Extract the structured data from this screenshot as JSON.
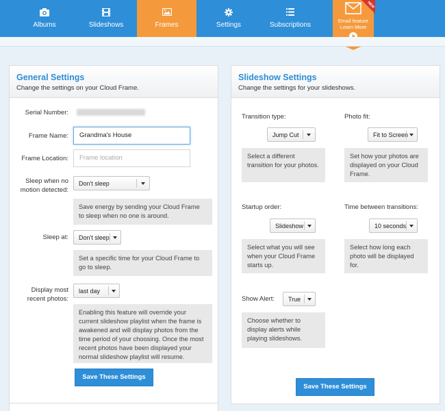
{
  "nav": {
    "items": [
      {
        "label": "Albums",
        "icon": "camera-icon"
      },
      {
        "label": "Slideshows",
        "icon": "film-icon"
      },
      {
        "label": "Frames",
        "icon": "image-icon"
      },
      {
        "label": "Settings",
        "icon": "gear-icon"
      },
      {
        "label": "Subscriptions",
        "icon": "list-icon"
      }
    ],
    "active": "Frames",
    "email_banner": {
      "line1": "Email feature",
      "line2": "Learn More",
      "ribbon": "NEW"
    }
  },
  "colors": {
    "nav_bg": "#2e8ed8",
    "active": "#f49a3c",
    "title": "#2e8ed8",
    "button": "#2e8ed8"
  },
  "general": {
    "title": "General Settings",
    "subtitle": "Change the settings on your Cloud Frame.",
    "serial_label": "Serial Number:",
    "frame_name_label": "Frame Name:",
    "frame_name_value": "Grandma's House",
    "frame_location_label": "Frame Location:",
    "frame_location_placeholder": "Frame location",
    "sleep_motion_label_1": "Sleep when no",
    "sleep_motion_label_2": "motion detected:",
    "sleep_motion_value": "Don't sleep",
    "sleep_motion_help": "Save energy by sending your Cloud Frame to sleep when no one is around.",
    "sleep_at_label": "Sleep at:",
    "sleep_at_value": "Don't sleep",
    "sleep_at_help": "Set a specific time for your Cloud Frame to go to sleep.",
    "recent_label_1": "Display most",
    "recent_label_2": "recent photos:",
    "recent_value": "last day",
    "recent_help": "Enabling this feature will override your current slideshow playlist when the frame is awakened and will display photos from the time period of your choosing. Once the most recent photos have been displayed your normal slideshow playlist will resume.",
    "save_label": "Save These Settings"
  },
  "slideshow": {
    "title": "Slideshow Settings",
    "subtitle": "Change the settings for your slideshows.",
    "transition_label": "Transition type:",
    "transition_value": "Jump Cut",
    "transition_help": "Select a different transition for your photos.",
    "photofit_label": "Photo fit:",
    "photofit_value": "Fit to Screen",
    "photofit_help": "Set how your photos are displayed on your Cloud Frame.",
    "startup_label": "Startup order:",
    "startup_value": "Slideshow",
    "startup_help": "Select what you will see when your Cloud Frame starts up.",
    "between_label": "Time between transitions:",
    "between_value": "10 seconds",
    "between_help": "Select how long each photo will be displayed for.",
    "alert_label": "Show Alert:",
    "alert_value": "True",
    "alert_help": "Choose whether to display alerts while playing slideshows.",
    "save_label": "Save These Settings"
  }
}
